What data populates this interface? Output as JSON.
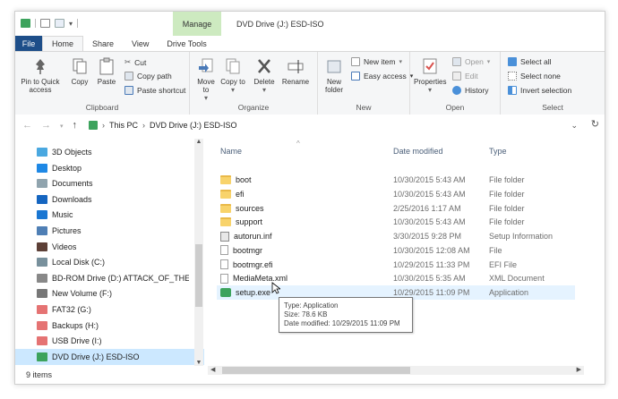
{
  "window": {
    "title": "DVD Drive (J:) ESD-ISO",
    "context_tab": "Manage"
  },
  "ribbon_tabs": [
    "File",
    "Home",
    "Share",
    "View",
    "Drive Tools"
  ],
  "ribbon": {
    "clipboard": {
      "label": "Clipboard",
      "pin": "Pin to Quick access",
      "copy": "Copy",
      "paste": "Paste",
      "cut": "Cut",
      "copy_path": "Copy path",
      "paste_shortcut": "Paste shortcut"
    },
    "organize": {
      "label": "Organize",
      "move_to": "Move to",
      "copy_to": "Copy to",
      "delete": "Delete",
      "rename": "Rename"
    },
    "new": {
      "label": "New",
      "new_folder": "New folder",
      "new_item": "New item",
      "easy_access": "Easy access"
    },
    "open": {
      "label": "Open",
      "properties": "Properties",
      "open": "Open",
      "edit": "Edit",
      "history": "History"
    },
    "select": {
      "label": "Select",
      "select_all": "Select all",
      "select_none": "Select none",
      "invert_selection": "Invert selection"
    }
  },
  "address": {
    "path": [
      "This PC",
      "DVD Drive (J:) ESD-ISO"
    ]
  },
  "nav_items": [
    {
      "label": "3D Objects",
      "color": "#4aa8e0"
    },
    {
      "label": "Desktop",
      "color": "#1e88e5"
    },
    {
      "label": "Documents",
      "color": "#90a4ae"
    },
    {
      "label": "Downloads",
      "color": "#1565c0"
    },
    {
      "label": "Music",
      "color": "#1976d2"
    },
    {
      "label": "Pictures",
      "color": "#4f7fb5"
    },
    {
      "label": "Videos",
      "color": "#5d4037"
    },
    {
      "label": "Local Disk (C:)",
      "color": "#78909c"
    },
    {
      "label": "BD-ROM Drive (D:) ATTACK_OF_THE_CLC",
      "color": "#888888"
    },
    {
      "label": "New Volume (F:)",
      "color": "#777777"
    },
    {
      "label": "FAT32 (G:)",
      "color": "#e57373"
    },
    {
      "label": "Backups (H:)",
      "color": "#e57373"
    },
    {
      "label": "USB Drive (I:)",
      "color": "#e57373"
    },
    {
      "label": "DVD Drive (J:) ESD-ISO",
      "color": "#3da35d"
    }
  ],
  "columns": {
    "name": "Name",
    "date": "Date modified",
    "type": "Type"
  },
  "files": [
    {
      "name": "boot",
      "date": "10/30/2015 5:43 AM",
      "type": "File folder",
      "icon": "folder-icon"
    },
    {
      "name": "efi",
      "date": "10/30/2015 5:43 AM",
      "type": "File folder",
      "icon": "folder-icon"
    },
    {
      "name": "sources",
      "date": "2/25/2016 1:17 AM",
      "type": "File folder",
      "icon": "folder-icon"
    },
    {
      "name": "support",
      "date": "10/30/2015 5:43 AM",
      "type": "File folder",
      "icon": "folder-icon"
    },
    {
      "name": "autorun.inf",
      "date": "3/30/2015 9:28 PM",
      "type": "Setup Information",
      "icon": "inf-icon"
    },
    {
      "name": "bootmgr",
      "date": "10/30/2015 12:08 AM",
      "type": "File",
      "icon": "file-icon"
    },
    {
      "name": "bootmgr.efi",
      "date": "10/29/2015 11:33 PM",
      "type": "EFI File",
      "icon": "file-icon"
    },
    {
      "name": "MediaMeta.xml",
      "date": "10/30/2015 5:35 AM",
      "type": "XML Document",
      "icon": "file-icon"
    },
    {
      "name": "setup.exe",
      "date": "10/29/2015 11:09 PM",
      "type": "Application",
      "icon": "app-icon"
    }
  ],
  "tooltip": {
    "type": "Type: Application",
    "size": "Size: 78.6 KB",
    "modified": "Date modified: 10/29/2015 11:09 PM"
  },
  "status": "9 items"
}
